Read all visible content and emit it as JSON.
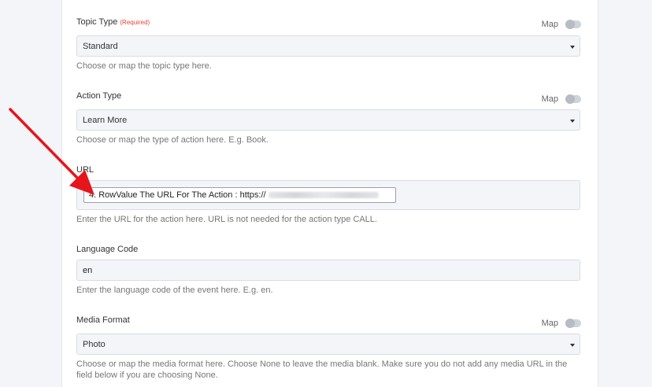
{
  "fields": {
    "topic_type": {
      "label": "Topic Type",
      "required": "(Required)",
      "map_label": "Map",
      "value": "Standard",
      "help": "Choose or map the topic type here."
    },
    "action_type": {
      "label": "Action Type",
      "map_label": "Map",
      "value": "Learn More",
      "help": "Choose or map the type of action here. E.g. Book."
    },
    "url": {
      "label": "URL",
      "value": "4. RowValue The URL For The Action : https://",
      "help": "Enter the URL for the action here. URL is not needed for the action type CALL."
    },
    "language_code": {
      "label": "Language Code",
      "value": "en",
      "help": "Enter the language code of the event here. E.g. en."
    },
    "media_format": {
      "label": "Media Format",
      "map_label": "Map",
      "value": "Photo",
      "help": "Choose or map the media format here. Choose None to leave the media blank. Make sure you do not add any media URL in the field below if you are choosing None."
    }
  },
  "colors": {
    "accent_arrow": "#e5161b",
    "required": "#e0443c",
    "field_bg": "#f4f5f8"
  }
}
